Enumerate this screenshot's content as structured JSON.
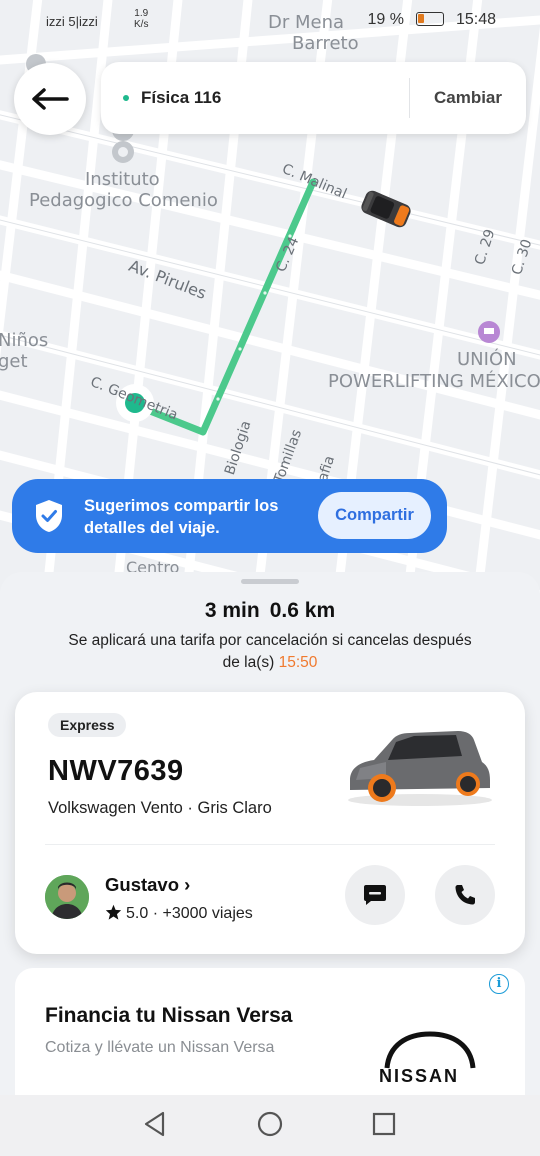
{
  "status_bar": {
    "carrier": "izzi 5|izzi",
    "speed_value": "1.9",
    "speed_unit": "K/s",
    "battery": "19 %",
    "time": "15:48"
  },
  "map": {
    "labels": {
      "top_place_1": "Dr Mena",
      "top_place_2": "Barreto",
      "institute_1": "Instituto",
      "institute_2": "Pedagogico Comenio",
      "pirules": "Av. Pirules",
      "ninos_1": "Niños",
      "ninos_2": "get",
      "union_1": "UNIÓN",
      "union_2": "POWERLIFTING MÉXICO",
      "malinal": "C. Malinal",
      "c24": "C. 24",
      "c29": "C. 29",
      "c30": "C. 30",
      "c_geometria": "C. Geometria",
      "biologia": "Biologia",
      "tomillas": "Tomillas",
      "centro": "Centro",
      "rafia": "rafia"
    }
  },
  "top_bar": {
    "destination": "Física 116",
    "change_label": "Cambiar"
  },
  "share_banner": {
    "message": "Sugerimos compartir los detalles del viaje.",
    "button_label": "Compartir"
  },
  "trip": {
    "eta_time": "3 min",
    "eta_distance": "0.6 km",
    "cancel_note": "Se aplicará una tarifa por cancelación si cancelas después de la(s)",
    "cancel_time": "15:50"
  },
  "driver_card": {
    "service": "Express",
    "plate": "NWV7639",
    "car_description": "Volkswagen Vento · Gris Claro",
    "driver_name": "Gustavo",
    "driver_name_chevron": "›",
    "rating": "5.0",
    "trips": "· +3000 viajes"
  },
  "ad": {
    "title": "Financia tu Nissan Versa",
    "subtitle": "Cotiza y llévate un Nissan Versa",
    "logo_text": "NISSAN",
    "info_glyph": "i"
  },
  "colors": {
    "route": "#4cc98c",
    "accent_blue": "#2f7be8",
    "cancel_time": "#f07a2f"
  }
}
